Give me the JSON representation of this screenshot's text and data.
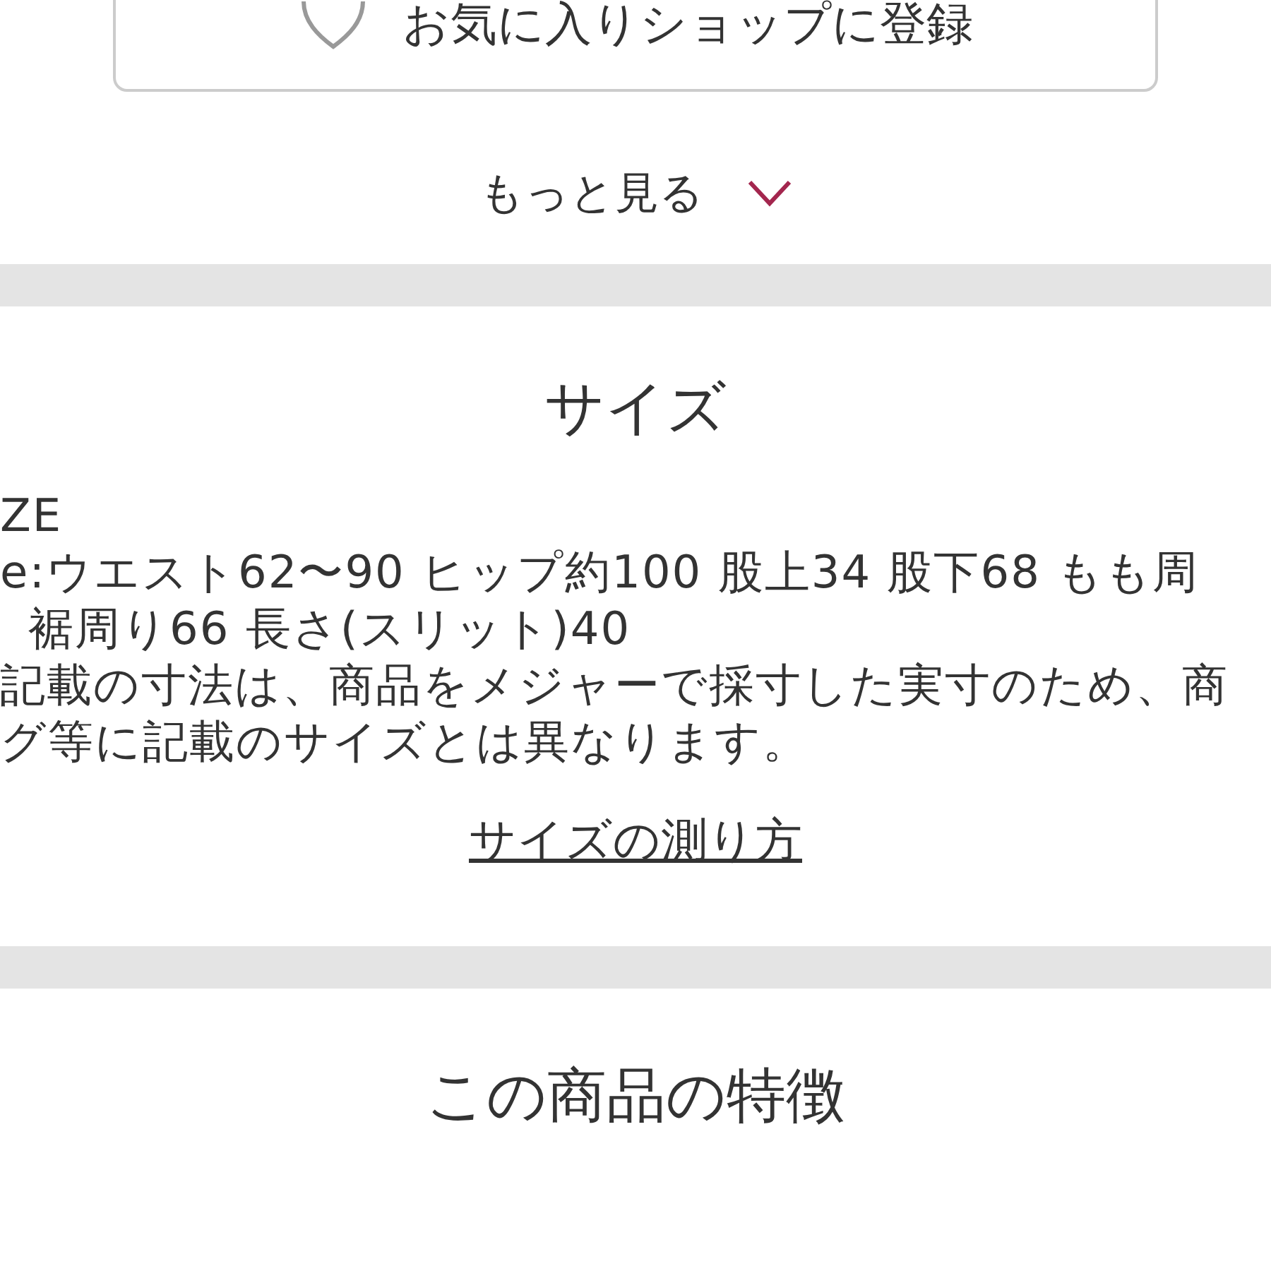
{
  "favorite_button": {
    "label": "お気に入りショップに登録"
  },
  "more_link": {
    "label": "もっと見る"
  },
  "size_section": {
    "title": "サイズ",
    "lines": [
      {
        "text": "ZE",
        "indent": false
      },
      {
        "text": "e:ウエスト62〜90 ヒップ約100 股上34 股下68 もも周",
        "indent": false
      },
      {
        "text": "裾周り66 長さ(スリット)40",
        "indent": true
      },
      {
        "text": "記載の寸法は、商品をメジャーで採寸した実寸のため、商",
        "indent": false
      },
      {
        "text": "グ等に記載のサイズとは異なります。",
        "indent": false
      }
    ],
    "link": "サイズの測り方"
  },
  "features_section": {
    "title": "この商品の特徴"
  }
}
